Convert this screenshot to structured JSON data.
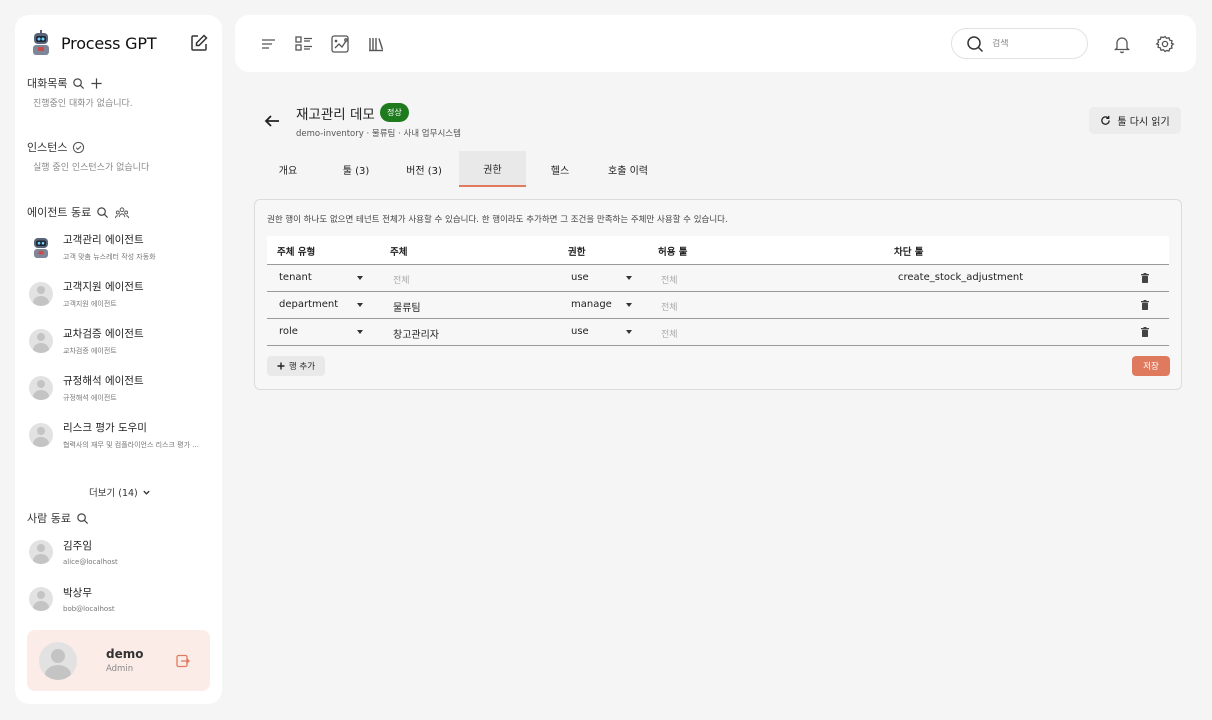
{
  "app": {
    "name": "Process GPT"
  },
  "sidebar": {
    "conversations": {
      "title": "대화목록",
      "empty": "진행중인 대화가 없습니다."
    },
    "instances": {
      "title": "인스턴스",
      "empty": "실행 중인 인스턴스가 없습니다"
    },
    "agents": {
      "title": "에이전트 동료",
      "items": [
        {
          "name": "고객관리 에이전트",
          "desc": "고객 맞춤 뉴스레터 작성 자동화"
        },
        {
          "name": "고객지원 에이전트",
          "desc": "고객지원 에이전트"
        },
        {
          "name": "교차검증 에이전트",
          "desc": "교차검증 에이전트"
        },
        {
          "name": "규정해석 에이전트",
          "desc": "규정해석 에이전트"
        },
        {
          "name": "리스크 평가 도우미",
          "desc": "협력사의 재무 및 컴플라이언스 리스크 평가 ..."
        }
      ],
      "more_label": "더보기 (14)"
    },
    "people": {
      "title": "사람 동료",
      "items": [
        {
          "name": "김주임",
          "email": "alice@localhost"
        },
        {
          "name": "박상무",
          "email": "bob@localhost"
        }
      ]
    },
    "user": {
      "name": "demo",
      "role": "Admin"
    }
  },
  "topbar": {
    "search_placeholder": "검색"
  },
  "page": {
    "title": "재고관리 데모",
    "status": "정상",
    "subtitle": "demo-inventory · 물류팀 · 사내 업무시스템",
    "reload_label": "툴 다시 읽기",
    "tabs": [
      {
        "label": "개요"
      },
      {
        "label": "툴 (3)"
      },
      {
        "label": "버전 (3)"
      },
      {
        "label": "권한",
        "active": true
      },
      {
        "label": "헬스"
      },
      {
        "label": "호출 이력"
      }
    ]
  },
  "permissions": {
    "hint": "권한 행이 하나도 없으면 테넌트 전체가 사용할 수 있습니다. 한 행이라도 추가하면 그 조건을 만족하는 주체만 사용할 수 있습니다.",
    "columns": [
      "주체 유형",
      "주체",
      "권한",
      "허용 툴",
      "차단 툴"
    ],
    "rows": [
      {
        "subject_type": "tenant",
        "subject": "",
        "subject_placeholder": "전체",
        "permission": "use",
        "allowed_placeholder": "전체",
        "blocked": "create_stock_adjustment"
      },
      {
        "subject_type": "department",
        "subject": "물류팀",
        "subject_placeholder": "",
        "permission": "manage",
        "allowed_placeholder": "전체",
        "blocked": ""
      },
      {
        "subject_type": "role",
        "subject": "창고관리자",
        "subject_placeholder": "",
        "permission": "use",
        "allowed_placeholder": "전체",
        "blocked": ""
      }
    ],
    "add_row_label": "행 추가",
    "save_label": "저장"
  },
  "colors": {
    "accent": "#e07a5f",
    "status_ok": "#1d7a1d"
  }
}
